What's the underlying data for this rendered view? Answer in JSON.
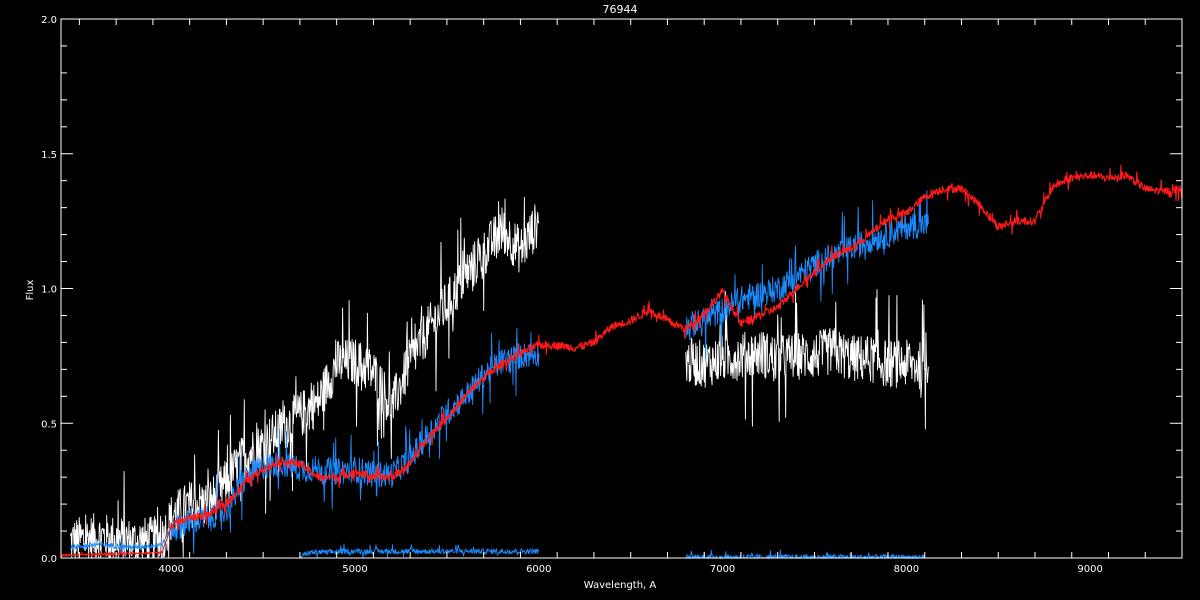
{
  "chart_data": {
    "type": "line",
    "title": "76944",
    "xlabel": "Wavelength, A",
    "ylabel": "Flux",
    "xlim": [
      3400,
      9500
    ],
    "ylim": [
      0,
      2.0
    ],
    "x_ticks": [
      4000,
      5000,
      6000,
      7000,
      8000,
      9000
    ],
    "y_ticks": [
      0.0,
      0.5,
      1.0,
      1.5,
      2.0
    ],
    "y_tick_labels": [
      "0.0",
      "0.5",
      "1.0",
      "1.5",
      "2.0"
    ],
    "background": "#000000",
    "axis_color": "#ffffff",
    "series": [
      {
        "color": "#ffffff",
        "noise": 0.09,
        "segments": [
          [
            [
              3450,
              0.06
            ],
            [
              3600,
              0.08
            ],
            [
              3800,
              0.06
            ],
            [
              3950,
              0.07
            ],
            [
              4000,
              0.15
            ],
            [
              4100,
              0.2
            ],
            [
              4200,
              0.2
            ],
            [
              4300,
              0.28
            ],
            [
              4400,
              0.38
            ],
            [
              4500,
              0.42
            ],
            [
              4600,
              0.48
            ],
            [
              4700,
              0.53
            ],
            [
              4800,
              0.58
            ],
            [
              4900,
              0.72
            ],
            [
              5000,
              0.73
            ],
            [
              5100,
              0.69
            ],
            [
              5200,
              0.56
            ],
            [
              5300,
              0.73
            ],
            [
              5400,
              0.85
            ],
            [
              5500,
              0.94
            ],
            [
              5600,
              1.05
            ],
            [
              5700,
              1.13
            ],
            [
              5800,
              1.22
            ],
            [
              5900,
              1.14
            ],
            [
              6000,
              1.25
            ]
          ],
          [
            [
              6800,
              0.73
            ],
            [
              6900,
              0.72
            ],
            [
              7000,
              0.74
            ],
            [
              7100,
              0.75
            ],
            [
              7200,
              0.76
            ],
            [
              7300,
              0.74
            ],
            [
              7400,
              0.75
            ],
            [
              7500,
              0.75
            ],
            [
              7600,
              0.77
            ],
            [
              7700,
              0.74
            ],
            [
              7800,
              0.74
            ],
            [
              7900,
              0.72
            ],
            [
              8000,
              0.72
            ],
            [
              8120,
              0.71
            ]
          ]
        ]
      },
      {
        "color": "#1a8cff",
        "noise": 0.05,
        "segments": [
          [
            [
              3450,
              0.04
            ],
            [
              3600,
              0.05
            ],
            [
              3800,
              0.04
            ],
            [
              3950,
              0.05
            ],
            [
              4000,
              0.11
            ],
            [
              4100,
              0.13
            ],
            [
              4200,
              0.15
            ],
            [
              4300,
              0.18
            ],
            [
              4400,
              0.29
            ],
            [
              4500,
              0.34
            ],
            [
              4600,
              0.35
            ],
            [
              4700,
              0.33
            ],
            [
              4800,
              0.33
            ],
            [
              4900,
              0.32
            ],
            [
              5000,
              0.33
            ],
            [
              5100,
              0.31
            ],
            [
              5200,
              0.31
            ],
            [
              5300,
              0.37
            ],
            [
              5400,
              0.46
            ],
            [
              5500,
              0.54
            ],
            [
              5600,
              0.6
            ],
            [
              5700,
              0.68
            ],
            [
              5800,
              0.73
            ],
            [
              5900,
              0.75
            ],
            [
              6000,
              0.76
            ]
          ],
          [
            [
              6800,
              0.86
            ],
            [
              6900,
              0.88
            ],
            [
              7000,
              0.92
            ],
            [
              7100,
              0.96
            ],
            [
              7200,
              0.98
            ],
            [
              7300,
              1.0
            ],
            [
              7400,
              1.04
            ],
            [
              7500,
              1.09
            ],
            [
              7600,
              1.12
            ],
            [
              7700,
              1.15
            ],
            [
              7800,
              1.18
            ],
            [
              7900,
              1.2
            ],
            [
              8000,
              1.23
            ],
            [
              8120,
              1.24
            ]
          ],
          [
            [
              4700,
              0.005
            ],
            [
              4750,
              0.02
            ],
            [
              5000,
              0.025
            ],
            [
              5500,
              0.025
            ],
            [
              6000,
              0.025
            ]
          ],
          [
            [
              6800,
              0.003
            ],
            [
              8100,
              0.003
            ]
          ]
        ]
      },
      {
        "color": "#ff1a1a",
        "noise": 0.015,
        "segments": [
          [
            [
              3400,
              0.01
            ],
            [
              3950,
              0.02
            ],
            [
              4000,
              0.12
            ],
            [
              4100,
              0.15
            ],
            [
              4200,
              0.16
            ],
            [
              4300,
              0.2
            ],
            [
              4400,
              0.28
            ],
            [
              4500,
              0.33
            ],
            [
              4600,
              0.36
            ],
            [
              4700,
              0.35
            ],
            [
              4800,
              0.3
            ],
            [
              4900,
              0.3
            ],
            [
              5000,
              0.32
            ],
            [
              5100,
              0.3
            ],
            [
              5200,
              0.3
            ],
            [
              5300,
              0.35
            ],
            [
              5400,
              0.45
            ],
            [
              5500,
              0.52
            ],
            [
              5600,
              0.6
            ],
            [
              5700,
              0.67
            ],
            [
              5800,
              0.72
            ],
            [
              5900,
              0.76
            ],
            [
              6000,
              0.79
            ],
            [
              6100,
              0.79
            ],
            [
              6200,
              0.78
            ],
            [
              6300,
              0.8
            ],
            [
              6400,
              0.86
            ],
            [
              6500,
              0.88
            ],
            [
              6600,
              0.92
            ],
            [
              6700,
              0.88
            ],
            [
              6800,
              0.85
            ],
            [
              6900,
              0.91
            ],
            [
              7000,
              0.99
            ],
            [
              7100,
              0.87
            ],
            [
              7200,
              0.9
            ],
            [
              7300,
              0.93
            ],
            [
              7400,
              1.0
            ],
            [
              7500,
              1.06
            ],
            [
              7600,
              1.12
            ],
            [
              7700,
              1.15
            ],
            [
              7800,
              1.2
            ],
            [
              7900,
              1.26
            ],
            [
              8000,
              1.28
            ],
            [
              8100,
              1.34
            ],
            [
              8200,
              1.37
            ],
            [
              8300,
              1.37
            ],
            [
              8400,
              1.31
            ],
            [
              8500,
              1.23
            ],
            [
              8600,
              1.25
            ],
            [
              8700,
              1.25
            ],
            [
              8800,
              1.38
            ],
            [
              8900,
              1.41
            ],
            [
              9000,
              1.42
            ],
            [
              9100,
              1.41
            ],
            [
              9200,
              1.42
            ],
            [
              9300,
              1.37
            ],
            [
              9400,
              1.36
            ],
            [
              9500,
              1.37
            ]
          ]
        ]
      }
    ]
  }
}
